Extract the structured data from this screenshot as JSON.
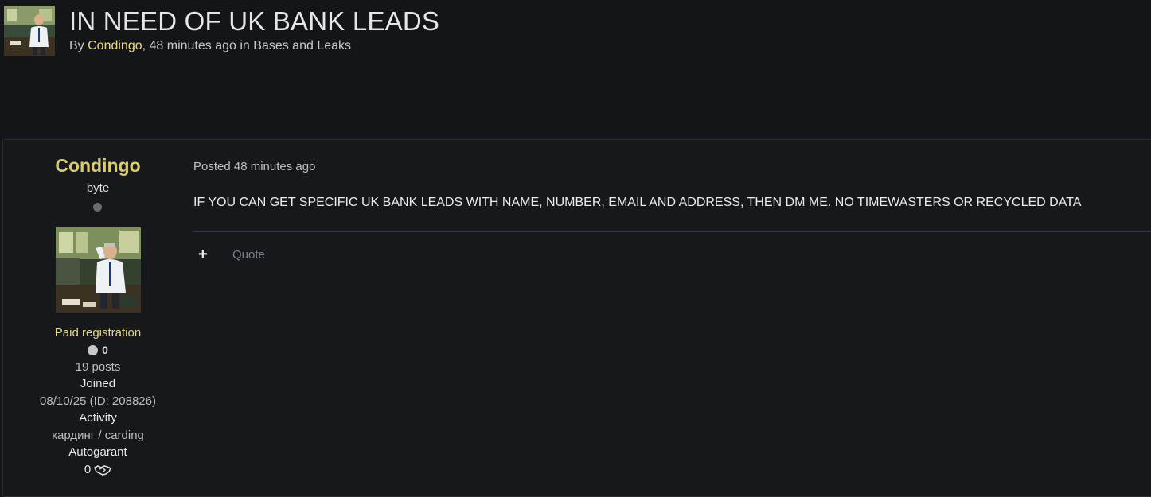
{
  "topic": {
    "title": "IN NEED OF UK BANK LEADS",
    "by_prefix": "By ",
    "author": "Condingo",
    "meta_middle": ", 48 minutes ago in ",
    "forum": "Bases and Leaks"
  },
  "author_panel": {
    "name": "Condingo",
    "rank": "byte",
    "group": "Paid registration",
    "reputation": "0",
    "posts": "19 posts",
    "joined_label": "Joined",
    "joined_value": "08/10/25 (ID: 208826)",
    "activity_label": "Activity",
    "activity_value": "кардинг / carding",
    "autogarant_label": "Autogarant",
    "deals_count": "0"
  },
  "post": {
    "posted_label": "Posted 48 minutes ago",
    "body": "IF YOU CAN GET SPECIFIC UK BANK LEADS WITH NAME, NUMBER, EMAIL AND ADDRESS, THEN DM ME. NO TIMEWASTERS OR RECYCLED DATA",
    "plus_label": "+",
    "quote_label": "Quote"
  },
  "colors": {
    "background": "#141519",
    "username": "#d9cc70",
    "group": "#e1d77f"
  },
  "icons": {
    "status": "offline-status-dot",
    "reputation": "reputation-dot-icon",
    "deals": "handshake-icon"
  }
}
